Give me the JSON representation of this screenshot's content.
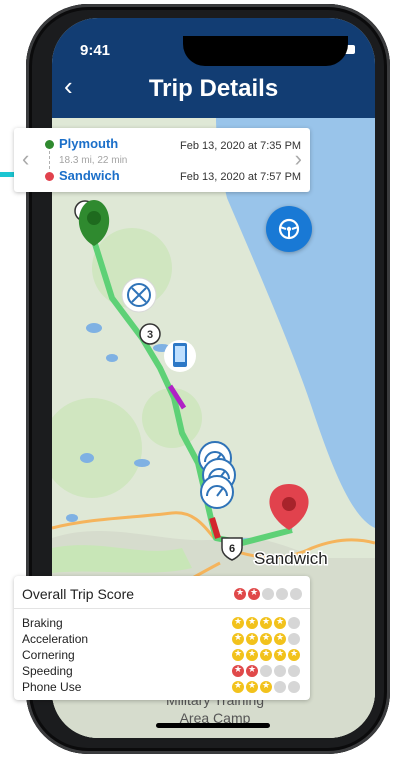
{
  "status_bar": {
    "time": "9:41"
  },
  "header": {
    "back_glyph": "‹",
    "title": "Trip Details"
  },
  "trip": {
    "start_place": "Plymouth",
    "start_time": "Feb 13, 2020 at 7:35 PM",
    "summary": "18.3 mi, 22 min",
    "end_place": "Sandwich",
    "end_time": "Feb 13, 2020 at 7:57 PM"
  },
  "map": {
    "town_label": "Sandwich",
    "route_badge": "6",
    "marker_count_a": "3",
    "marker_count_b": "3",
    "bottom_label_1": "Military Training",
    "bottom_label_2": "Area Camp"
  },
  "score": {
    "title": "Overall Trip Score",
    "overall": {
      "filled": 2,
      "color": "red"
    },
    "items": [
      {
        "label": "Braking",
        "filled": 4,
        "color": "gold"
      },
      {
        "label": "Acceleration",
        "filled": 4,
        "color": "gold"
      },
      {
        "label": "Cornering",
        "filled": 5,
        "color": "gold"
      },
      {
        "label": "Speeding",
        "filled": 2,
        "color": "red"
      },
      {
        "label": "Phone Use",
        "filled": 3,
        "color": "gold"
      }
    ]
  },
  "icons": [
    "back-arrow-icon",
    "steering-wheel-icon",
    "phone-use-icon",
    "speedometer-icon",
    "hard-brake-icon"
  ],
  "colors": {
    "header": "#123d73",
    "route": "#5ed176",
    "start": "#2f8a2f",
    "end": "#e1424d",
    "accent": "#1979d5"
  }
}
